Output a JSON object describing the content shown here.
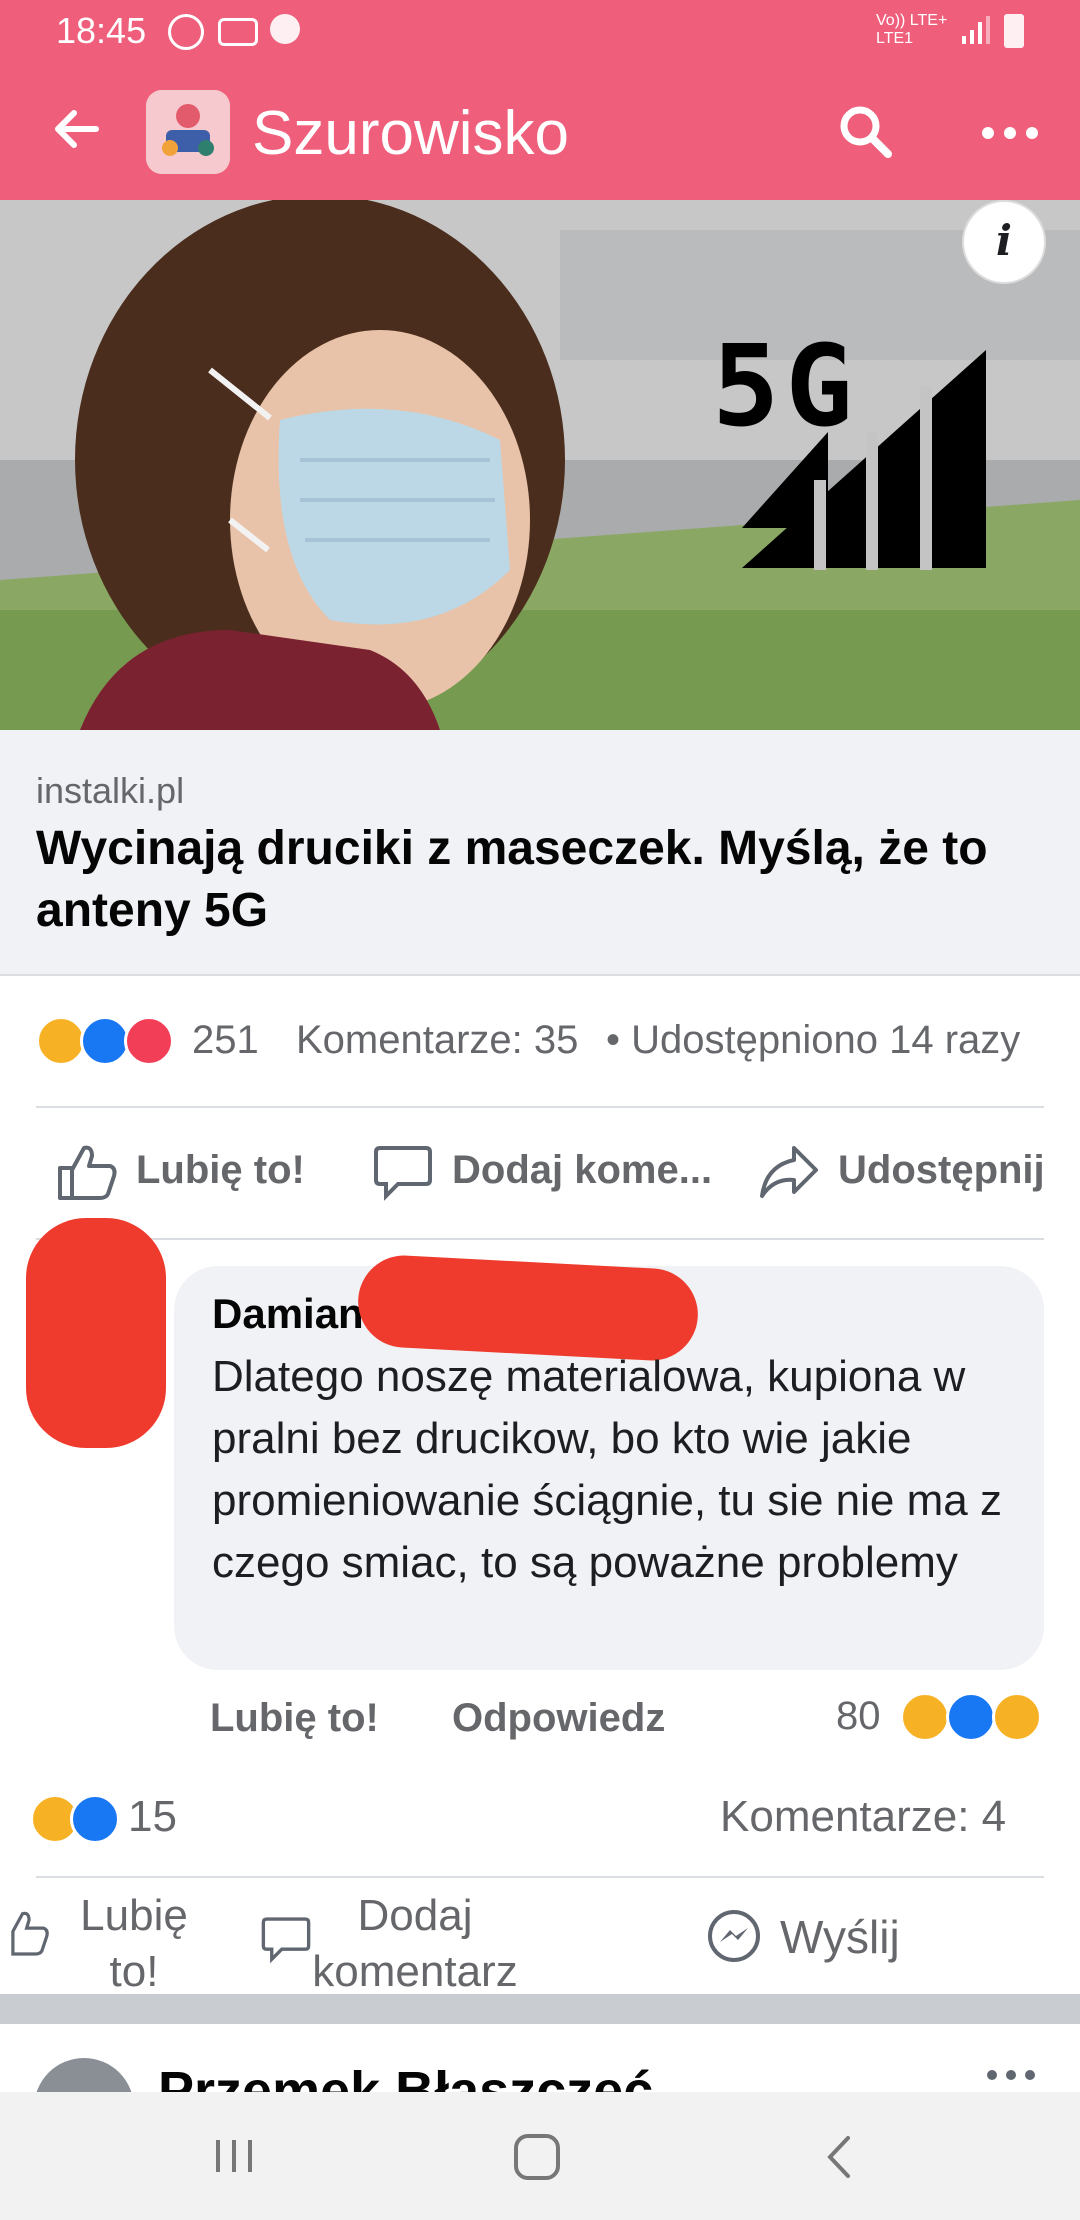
{
  "status_bar": {
    "time": "18:45",
    "network": "Vo)) LTE+\nLTE1"
  },
  "app_bar": {
    "group_name": "Szurowisko",
    "icons": [
      "back-arrow-icon",
      "search-icon",
      "more-icon"
    ]
  },
  "post": {
    "image_text": "5G",
    "info_icon": "i",
    "link_domain": "instalki.pl",
    "link_title": "Wycinają druciki z maseczek. Myślą, że to anteny 5G",
    "reaction_count": "251",
    "comments_label": "Komentarze: 35",
    "shares_label": "• Udostępniono 14 razy",
    "actions": {
      "like": "Lubię to!",
      "comment": "Dodaj kome...",
      "share": "Udostępnij"
    }
  },
  "comment": {
    "author": "Damian",
    "text": "Dlatego noszę materialowa, kupiona w pralni  bez drucikow, bo kto wie jakie promieniowanie ściągnie, tu sie nie ma z czego smiac, to są poważne problemy",
    "like": "Lubię to!",
    "reply": "Odpowiedz",
    "reaction_count": "80"
  },
  "summary": {
    "reaction_count": "15",
    "comments_label": "Komentarze: 4",
    "like": "Lubię to!",
    "comment": "Dodaj komentarz",
    "send": "Wyślij"
  },
  "next_post": {
    "author_partial": "Przemek Błaszczeć"
  },
  "colors": {
    "brand": "#ef5f7c",
    "text_secondary": "#65676b"
  }
}
